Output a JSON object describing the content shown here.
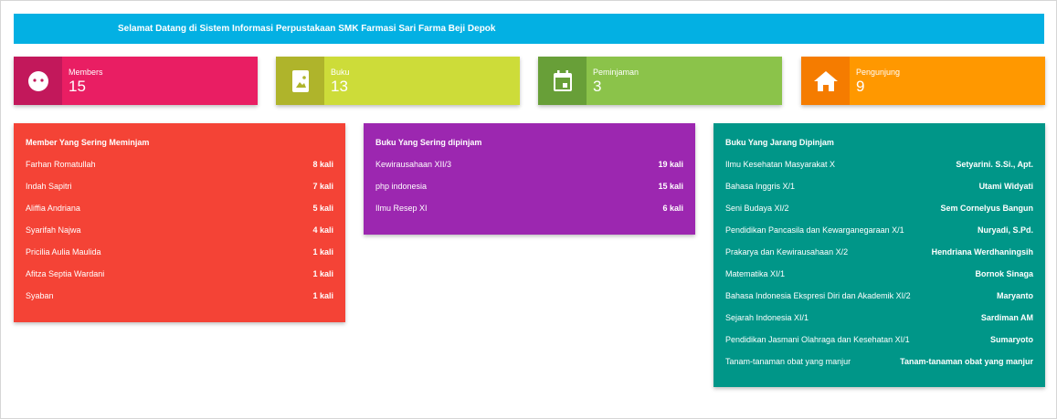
{
  "banner": {
    "text": "Selamat Datang di Sistem Informasi Perpustakaan SMK Farmasi Sari Farma Beji Depok"
  },
  "stats": {
    "members": {
      "label": "Members",
      "value": "15",
      "icon": "face-icon"
    },
    "buku": {
      "label": "Buku",
      "value": "13",
      "icon": "book-icon"
    },
    "peminjaman": {
      "label": "Peminjaman",
      "value": "3",
      "icon": "calendar-icon"
    },
    "pengunjung": {
      "label": "Pengunjung",
      "value": "9",
      "icon": "home-icon"
    }
  },
  "colors": {
    "banner": "#03b0e3",
    "members": "#e91e63",
    "buku": "#cddc39",
    "peminjaman": "#8bc34a",
    "pengunjung": "#ff9800",
    "panel_members": "#f44336",
    "panel_often": "#9c27b0",
    "panel_rare": "#009688"
  },
  "panels": {
    "members": {
      "title": "Member Yang Sering Meminjam",
      "rows": [
        {
          "name": "Farhan Romatullah",
          "value": "8 kali"
        },
        {
          "name": "Indah Sapitri",
          "value": "7 kali"
        },
        {
          "name": "Aliffia Andriana",
          "value": "5 kali"
        },
        {
          "name": "Syarifah Najwa",
          "value": "4 kali"
        },
        {
          "name": "Pricilia Aulia Maulida",
          "value": "1 kali"
        },
        {
          "name": "Afitza Septia Wardani",
          "value": "1 kali"
        },
        {
          "name": "Syaban",
          "value": "1 kali"
        }
      ]
    },
    "often": {
      "title": "Buku Yang Sering dipinjam",
      "rows": [
        {
          "name": "Kewirausahaan XII/3",
          "value": "19 kali"
        },
        {
          "name": "php indonesia",
          "value": "15 kali"
        },
        {
          "name": "Ilmu Resep XI",
          "value": "6 kali"
        }
      ]
    },
    "rare": {
      "title": "Buku Yang Jarang Dipinjam",
      "rows": [
        {
          "name": "Ilmu Kesehatan Masyarakat X",
          "value": "Setyarini. S.Si., Apt."
        },
        {
          "name": "Bahasa Inggris X/1",
          "value": "Utami Widyati"
        },
        {
          "name": "Seni Budaya XI/2",
          "value": "Sem Cornelyus Bangun"
        },
        {
          "name": "Pendidikan Pancasila dan Kewarganegaraan X/1",
          "value": "Nuryadi, S.Pd."
        },
        {
          "name": "Prakarya dan Kewirausahaan X/2",
          "value": "Hendriana Werdhaningsih"
        },
        {
          "name": "Matematika XI/1",
          "value": "Bornok Sinaga"
        },
        {
          "name": "Bahasa Indonesia Ekspresi Diri dan Akademik XI/2",
          "value": "Maryanto"
        },
        {
          "name": "Sejarah Indonesia XI/1",
          "value": "Sardiman AM"
        },
        {
          "name": "Pendidikan Jasmani Olahraga dan Kesehatan XI/1",
          "value": "Sumaryoto"
        },
        {
          "name": "Tanam-tanaman obat yang manjur",
          "value": "Tanam-tanaman obat yang manjur"
        }
      ]
    }
  }
}
